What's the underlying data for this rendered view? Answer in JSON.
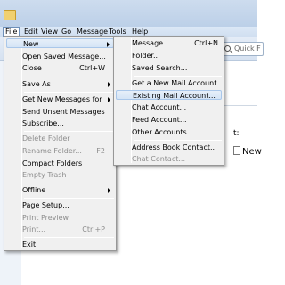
{
  "menubar": [
    "File",
    "Edit",
    "View",
    "Go",
    "Message",
    "Tools",
    "Help"
  ],
  "quick_filter_placeholder": "Quick F",
  "background": {
    "colon_fragment": "t:",
    "new_fragment": "New"
  },
  "file_menu": [
    {
      "label": "New",
      "submenu": true,
      "highlighted": true
    },
    {
      "label": "Open Saved Message..."
    },
    {
      "label": "Close",
      "shortcut": "Ctrl+W"
    },
    {
      "label": "Save As",
      "submenu": true
    },
    {
      "label": "Get New Messages for",
      "submenu": true
    },
    {
      "label": "Send Unsent Messages"
    },
    {
      "label": "Subscribe..."
    },
    {
      "label": "Delete Folder",
      "disabled": true
    },
    {
      "label": "Rename Folder...",
      "shortcut": "F2",
      "disabled": true
    },
    {
      "label": "Compact Folders"
    },
    {
      "label": "Empty Trash",
      "disabled": true
    },
    {
      "label": "Offline",
      "submenu": true
    },
    {
      "label": "Page Setup..."
    },
    {
      "label": "Print Preview",
      "disabled": true
    },
    {
      "label": "Print...",
      "shortcut": "Ctrl+P",
      "disabled": true
    },
    {
      "label": "Exit"
    }
  ],
  "new_menu": [
    {
      "label": "Message",
      "shortcut": "Ctrl+N"
    },
    {
      "label": "Folder..."
    },
    {
      "label": "Saved Search..."
    },
    {
      "label": "Get a New Mail Account..."
    },
    {
      "label": "Existing Mail Account...",
      "highlighted": true
    },
    {
      "label": "Chat Account..."
    },
    {
      "label": "Feed Account..."
    },
    {
      "label": "Other Accounts..."
    },
    {
      "label": "Address Book Contact..."
    },
    {
      "label": "Chat Contact...",
      "disabled": true
    }
  ]
}
